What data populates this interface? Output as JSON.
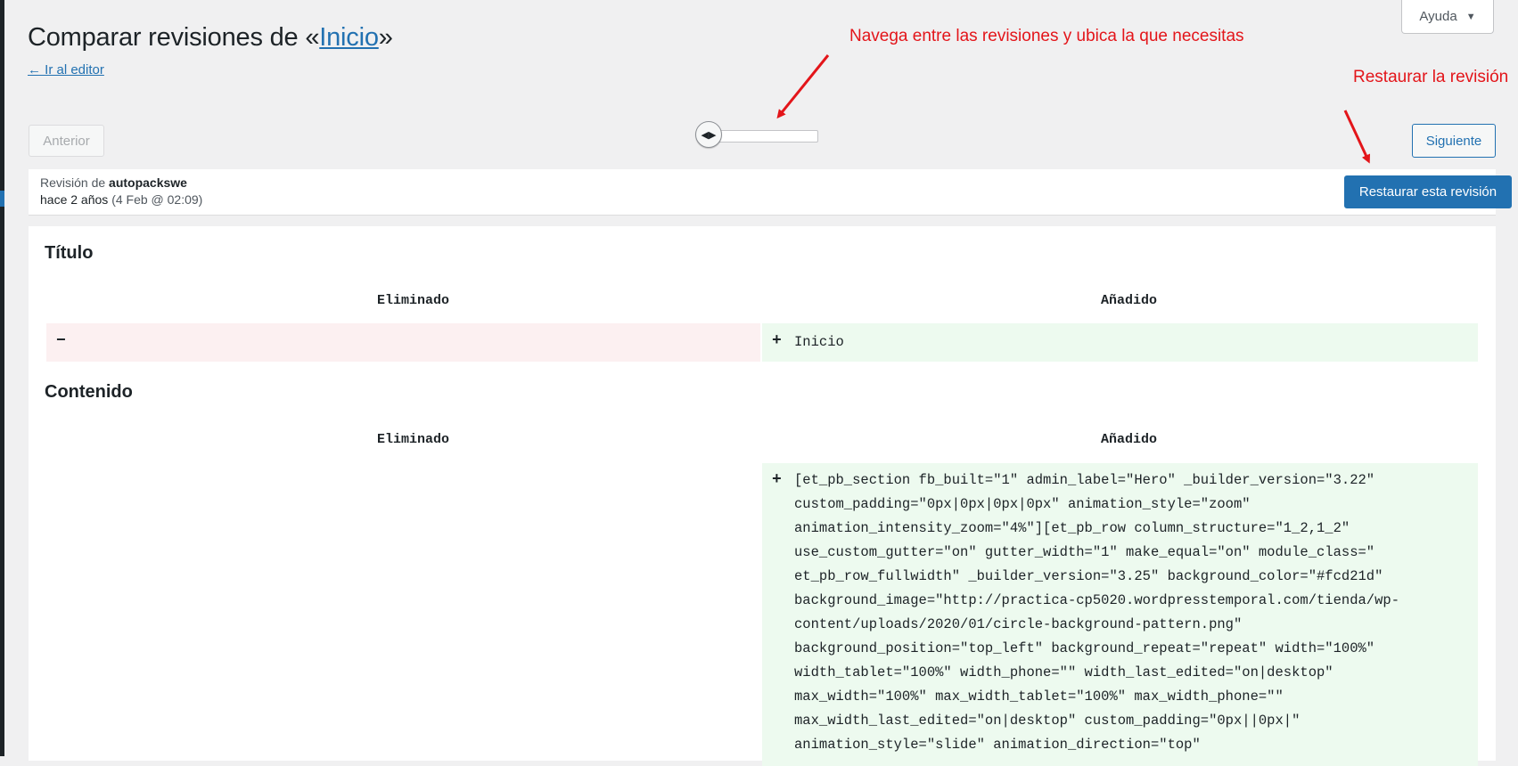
{
  "help": {
    "label": "Ayuda"
  },
  "title": {
    "prefix": "Comparar revisiones de «",
    "post_name": "Inicio",
    "suffix": "»"
  },
  "back_link": "← Ir al editor",
  "annotations": {
    "navigate": "Navega entre las revisiones y ubica la que necesitas",
    "restore": "Restaurar la revisión",
    "color": "#e3151a"
  },
  "nav": {
    "prev_label": "Anterior",
    "next_label": "Siguiente"
  },
  "revision": {
    "by_label": "Revisión de",
    "author": "autopackswe",
    "time_ago": "hace 2 años",
    "date": "(4 Feb @ 02:09)",
    "restore_button": "Restaurar esta revisión"
  },
  "diff": {
    "title_section": {
      "heading": "Título",
      "removed_header": "Eliminado",
      "added_header": "Añadido",
      "removed_sign": "−",
      "added_sign": "+",
      "added_text": "Inicio"
    },
    "content_section": {
      "heading": "Contenido",
      "removed_header": "Eliminado",
      "added_header": "Añadido",
      "added_sign": "+",
      "added_lines": [
        "[et_pb_section fb_built=\"1\" admin_label=\"Hero\" _builder_version=\"3.22\"",
        "custom_padding=\"0px|0px|0px|0px\" animation_style=\"zoom\"",
        "animation_intensity_zoom=\"4%\"][et_pb_row column_structure=\"1_2,1_2\"",
        "use_custom_gutter=\"on\" gutter_width=\"1\" make_equal=\"on\" module_class=\"",
        "et_pb_row_fullwidth\" _builder_version=\"3.25\" background_color=\"#fcd21d\"",
        "background_image=\"http://practica-cp5020.wordpresstemporal.com/tienda/wp-",
        "content/uploads/2020/01/circle-background-pattern.png\"",
        "background_position=\"top_left\" background_repeat=\"repeat\" width=\"100%\"",
        "width_tablet=\"100%\" width_phone=\"\" width_last_edited=\"on|desktop\"",
        "max_width=\"100%\" max_width_tablet=\"100%\" max_width_phone=\"\"",
        "max_width_last_edited=\"on|desktop\" custom_padding=\"0px||0px|\"",
        "animation_style=\"slide\" animation_direction=\"top\""
      ]
    }
  },
  "colors": {
    "accent": "#2271b1",
    "removed_bg": "#fcf0f1",
    "added_bg": "#edfaef",
    "page_bg": "#f0f0f1"
  }
}
